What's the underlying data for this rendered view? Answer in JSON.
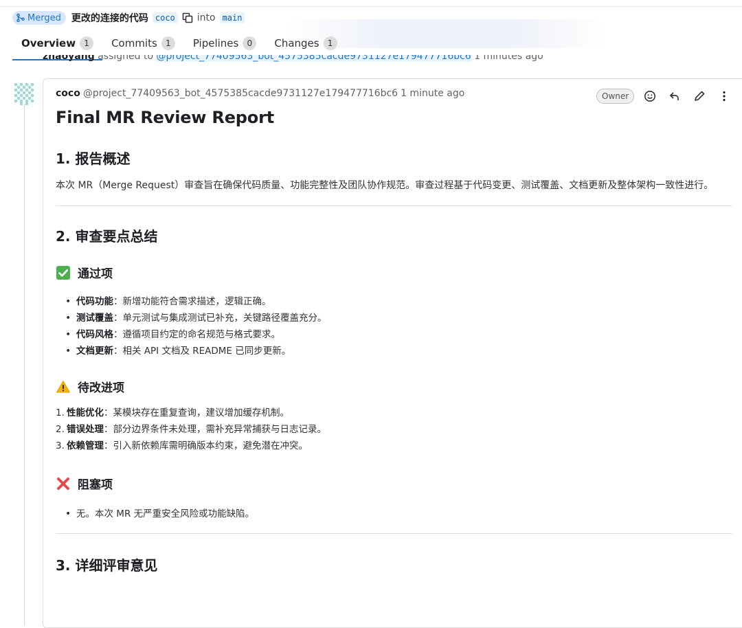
{
  "header": {
    "status": "Merged",
    "title": "更改的连接的代码",
    "source_branch": "coco",
    "into": "into",
    "target_branch": "main"
  },
  "tabs": [
    {
      "label": "Overview",
      "count": "1"
    },
    {
      "label": "Commits",
      "count": "1"
    },
    {
      "label": "Pipelines",
      "count": "0"
    },
    {
      "label": "Changes",
      "count": "1"
    }
  ],
  "activity": {
    "username": "zhaoyang",
    "action": "assigned to",
    "mention": "@project_77409563_bot_4575385cacde9731127e179477716bc6",
    "time": "1 minutes ago"
  },
  "note": {
    "author": "coco",
    "handle": "@project_77409563_bot_4575385cacde9731127e179477716bc6",
    "time": "1 minute ago",
    "role_badge": "Owner",
    "icons": [
      "smiley-icon",
      "reply-icon",
      "pencil-icon",
      "more-vertical-icon"
    ]
  },
  "report": {
    "title": "Final MR Review Report",
    "s1_heading": "1. 报告概述",
    "s1_text": "本次 MR（Merge Request）审查旨在确保代码质量、功能完整性及团队协作规范。审查过程基于代码变更、测试覆盖、文档更新及整体架构一致性进行。",
    "s2_heading": "2. 审查要点总结",
    "pass_heading": "通过项",
    "pass_items": [
      {
        "k": "代码功能",
        "v": "：新增功能符合需求描述，逻辑正确。"
      },
      {
        "k": "测试覆盖",
        "v": "：单元测试与集成测试已补充，关键路径覆盖充分。"
      },
      {
        "k": "代码风格",
        "v": "：遵循项目约定的命名规范与格式要求。"
      },
      {
        "k": "文档更新",
        "v": "：相关 API 文档及 README 已同步更新。"
      }
    ],
    "todo_heading": "待改进项",
    "todo_items": [
      {
        "n": "1.",
        "k": "性能优化",
        "v": "：某模块存在重复查询，建议增加缓存机制。"
      },
      {
        "n": "2.",
        "k": "错误处理",
        "v": "：部分边界条件未处理，需补充异常捕获与日志记录。"
      },
      {
        "n": "3.",
        "k": "依赖管理",
        "v": "：引入新依赖库需明确版本约束，避免潜在冲突。"
      }
    ],
    "block_heading": "阻塞项",
    "block_items": [
      "无。本次 MR 无严重安全风险或功能缺陷。"
    ],
    "s3_heading": "3. 详细评审意见"
  },
  "colors": {
    "accent": "#1f75cb",
    "pass": "#2da160",
    "warn": "#f0a300",
    "block": "#e5484d"
  }
}
